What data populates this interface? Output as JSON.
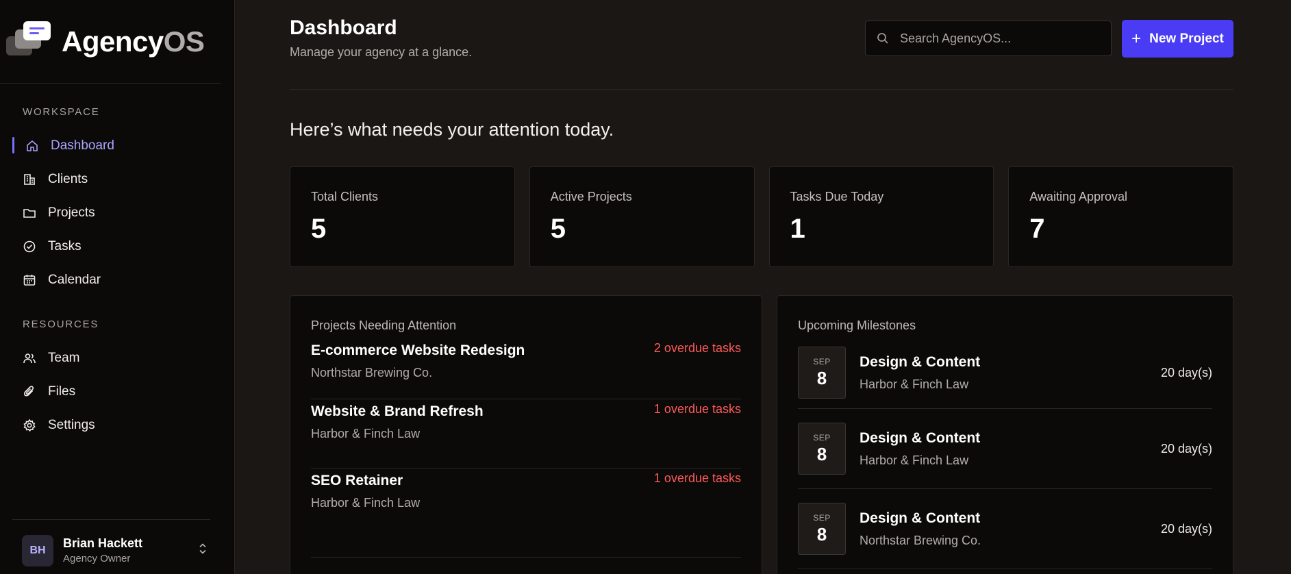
{
  "brand": {
    "name_main": "Agency",
    "name_accent": "OS"
  },
  "sidebar": {
    "workspace_heading": "WORKSPACE",
    "workspace_items": [
      {
        "label": "Dashboard",
        "icon": "home-icon",
        "active": true
      },
      {
        "label": "Clients",
        "icon": "building-icon"
      },
      {
        "label": "Projects",
        "icon": "folder-icon"
      },
      {
        "label": "Tasks",
        "icon": "check-circle-icon"
      },
      {
        "label": "Calendar",
        "icon": "calendar-icon"
      }
    ],
    "resources_heading": "RESOURCES",
    "resources_items": [
      {
        "label": "Team",
        "icon": "users-icon"
      },
      {
        "label": "Files",
        "icon": "paperclip-icon"
      },
      {
        "label": "Settings",
        "icon": "gear-icon"
      }
    ],
    "user": {
      "initials": "BH",
      "name": "Brian Hackett",
      "role": "Agency Owner"
    }
  },
  "header": {
    "title": "Dashboard",
    "subtitle": "Manage your agency at a glance.",
    "search_placeholder": "Search AgencyOS...",
    "new_project_label": "New Project"
  },
  "attention_heading": "Here’s what needs your attention today.",
  "stats": [
    {
      "label": "Total Clients",
      "value": "5"
    },
    {
      "label": "Active Projects",
      "value": "5"
    },
    {
      "label": "Tasks Due Today",
      "value": "1"
    },
    {
      "label": "Awaiting Approval",
      "value": "7"
    }
  ],
  "projects_panel": {
    "title": "Projects Needing Attention",
    "items": [
      {
        "name": "E-commerce Website Redesign",
        "client": "Northstar Brewing Co.",
        "overdue": "2 overdue tasks"
      },
      {
        "name": "Website & Brand Refresh",
        "client": "Harbor & Finch Law",
        "overdue": "1 overdue tasks"
      },
      {
        "name": "SEO Retainer",
        "client": "Harbor & Finch Law",
        "overdue": "1 overdue tasks"
      }
    ]
  },
  "milestones_panel": {
    "title": "Upcoming Milestones",
    "items": [
      {
        "month": "SEP",
        "day": "8",
        "name": "Design & Content",
        "client": "Harbor & Finch Law",
        "days": "20 day(s)"
      },
      {
        "month": "SEP",
        "day": "8",
        "name": "Design & Content",
        "client": "Harbor & Finch Law",
        "days": "20 day(s)"
      },
      {
        "month": "SEP",
        "day": "8",
        "name": "Design & Content",
        "client": "Northstar Brewing Co.",
        "days": "20 day(s)"
      }
    ]
  },
  "colors": {
    "accent": "#4a3cf5",
    "active_nav": "#a9a3ff",
    "overdue": "#ff5a5a",
    "background": "#1a1715",
    "panel": "#0b0a09"
  }
}
